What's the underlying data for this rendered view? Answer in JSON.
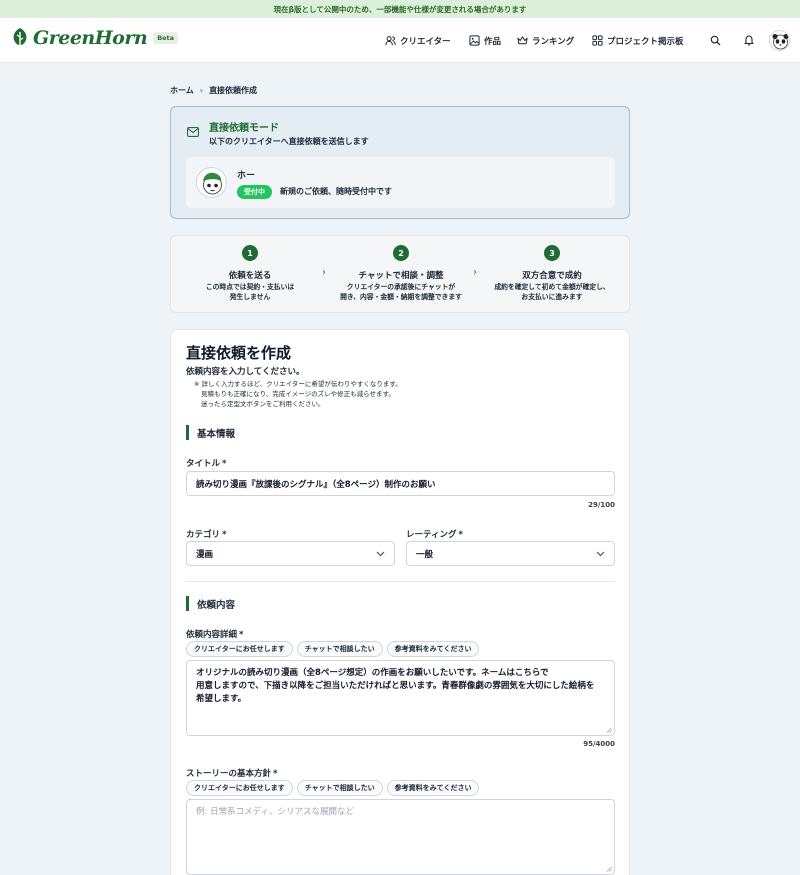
{
  "banner": {
    "text": "現在β版として公開中のため、一部機能や仕様が変更される場合があります"
  },
  "header": {
    "logo_text": "GreenHorn",
    "beta_label": "Beta",
    "nav": [
      {
        "label": "クリエイター",
        "icon": "users-icon"
      },
      {
        "label": "作品",
        "icon": "image-icon"
      },
      {
        "label": "ランキング",
        "icon": "crown-icon"
      },
      {
        "label": "プロジェクト掲示板",
        "icon": "grid-icon"
      }
    ]
  },
  "breadcrumb": {
    "home": "ホーム",
    "current": "直接依頼作成"
  },
  "mode": {
    "title": "直接依頼モード",
    "subtitle": "以下のクリエイターへ直接依頼を送信します",
    "creator_name": "ホー",
    "status_badge": "受付中",
    "status_text": "新規のご依頼、随時受付中です"
  },
  "steps": [
    {
      "num": "1",
      "title": "依頼を送る",
      "desc1": "この時点では契約・支払いは",
      "desc2": "発生しません"
    },
    {
      "num": "2",
      "title": "チャットで相談・調整",
      "desc1": "クリエイターの承認後にチャットが",
      "desc2": "開き、内容・金額・納期を調整できます"
    },
    {
      "num": "3",
      "title": "双方合意で成約",
      "desc1": "成約を確定して初めて金額が確定し、",
      "desc2": "お支払いに進みます"
    }
  ],
  "form": {
    "title": "直接依頼を作成",
    "subtitle": "依頼内容を入力してください。",
    "note_line1": "※ 詳しく入力するほど、クリエイターに希望が伝わりやすくなります。",
    "note_line2": "見積もりも正確になり、完成イメージのズレや修正も減らせます。",
    "note_line3": "迷ったら定型文ボタンをご利用ください。",
    "section_basic": "基本情報",
    "title_label": "タイトル",
    "title_value": "読み切り漫画『放課後のシグナル』（全8ページ）制作のお願い",
    "title_counter": "29/100",
    "category_label": "カテゴリ",
    "category_value": "漫画",
    "rating_label": "レーティング",
    "rating_value": "一般",
    "required_mark": "*",
    "section_content": "依頼内容",
    "detail_label": "依頼内容詳細",
    "chips": [
      "クリエイターにお任せします",
      "チャットで相談したい",
      "参考資料をみてください"
    ],
    "detail_line1": "オリジナルの読み切り漫画（全8ページ想定）の作画をお願いしたいです。ネームはこちらで",
    "detail_line2": "用意しますので、下描き以降をご担当いただければと思います。青春群像劇の雰囲気を大切にした絵柄を",
    "detail_line3": "希望します。",
    "detail_counter": "95/4000",
    "story_label": "ストーリーの基本方針",
    "story_placeholder": "例: 日常系コメディ、シリアスな展開など"
  }
}
